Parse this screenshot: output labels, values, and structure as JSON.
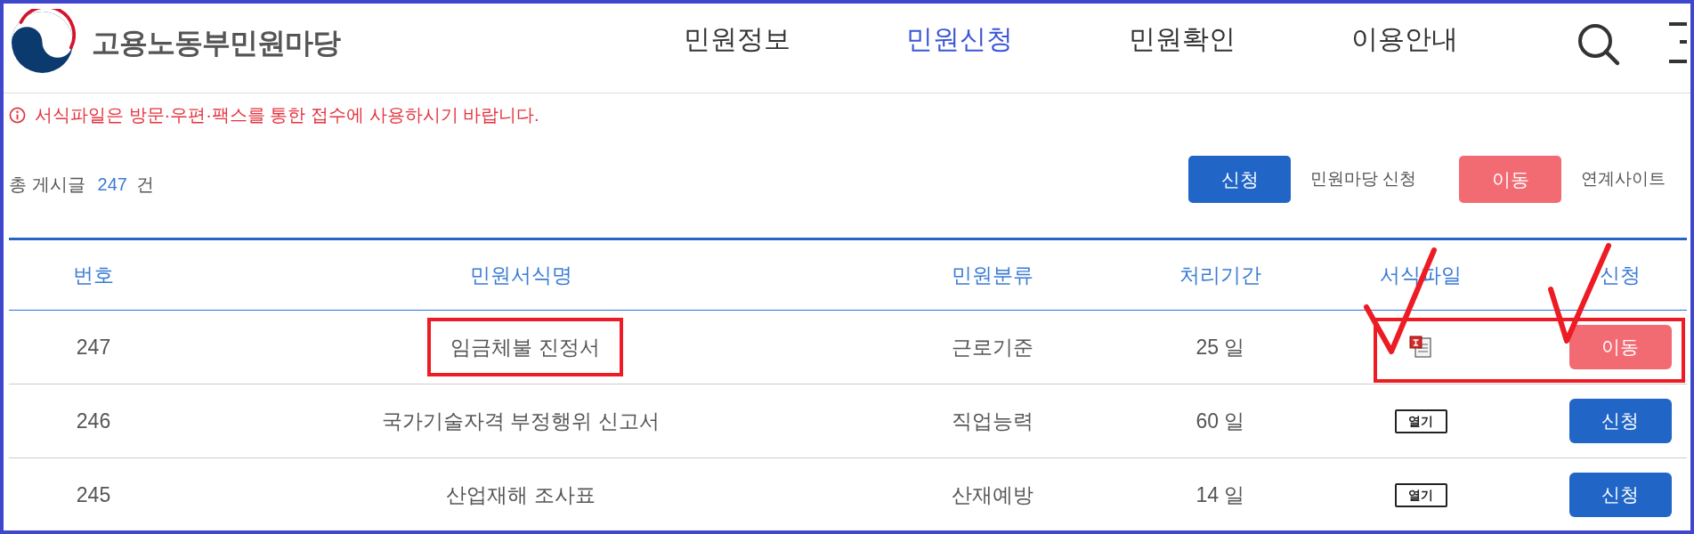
{
  "header": {
    "site_title": "고용노동부민원마당",
    "nav": [
      {
        "label": "민원정보",
        "selected": false
      },
      {
        "label": "민원신청",
        "selected": true
      },
      {
        "label": "민원확인",
        "selected": false
      },
      {
        "label": "이용안내",
        "selected": false
      }
    ]
  },
  "notice": "서식파일은 방문·우편·팩스를 통한 접수에 사용하시기 바랍니다.",
  "total": {
    "label": "총 게시글",
    "count": "247",
    "unit": "건"
  },
  "legend": [
    {
      "kind": "apply",
      "button": "신청",
      "caption": "민원마당 신청"
    },
    {
      "kind": "move",
      "button": "이동",
      "caption": "연계사이트"
    }
  ],
  "table": {
    "columns": [
      "번호",
      "민원서식명",
      "민원분류",
      "처리기간",
      "서식파일",
      "신청"
    ],
    "rows": [
      {
        "number": "247",
        "title": "임금체불 진정서",
        "category": "근로기준",
        "period": "25 일",
        "file": {
          "kind": "document"
        },
        "action": {
          "kind": "move",
          "label": "이동"
        },
        "annotated": true
      },
      {
        "number": "246",
        "title": "국가기술자격 부정행위 신고서",
        "category": "직업능력",
        "period": "60 일",
        "file": {
          "kind": "open",
          "label": "열기"
        },
        "action": {
          "kind": "apply",
          "label": "신청"
        },
        "annotated": false
      },
      {
        "number": "245",
        "title": "산업재해 조사표",
        "category": "산재예방",
        "period": "14 일",
        "file": {
          "kind": "open",
          "label": "열기"
        },
        "action": {
          "kind": "apply",
          "label": "신청"
        },
        "annotated": false
      }
    ]
  }
}
